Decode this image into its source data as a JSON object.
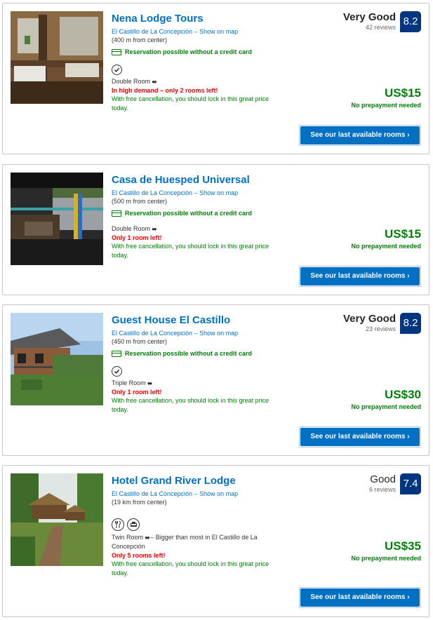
{
  "properties": [
    {
      "name": "Nena Lodge Tours",
      "location": "El Castillo de La Concepción – Show on map",
      "distance": "(400 m from center)",
      "reservation_note": "Reservation possible without a credit card",
      "feature_icons": [
        "check-badge-icon"
      ],
      "room": "Double Room",
      "room_extra": "",
      "demand": "In high demand – only 2 rooms left!",
      "cancel": "With free cancellation, you should lock in this great price today.",
      "review_word": "Very Good",
      "review_count": "42 reviews",
      "score": "8.2",
      "price": "US$15",
      "prepay": "No prepayment needed",
      "cta": "See our last available rooms ›"
    },
    {
      "name": "Casa de Huesped Universal",
      "location": "El Castillo de La Concepción – Show on map",
      "distance": "(500 m from center)",
      "reservation_note": "Reservation possible without a credit card",
      "feature_icons": [],
      "room": "Double Room",
      "room_extra": "",
      "demand": "Only 1 room left!",
      "cancel": "With free cancellation, you should lock in this great price today.",
      "review_word": "",
      "review_count": "",
      "score": "",
      "price": "US$15",
      "prepay": "No prepayment needed",
      "cta": "See our last available rooms ›"
    },
    {
      "name": "Guest House El Castillo",
      "location": "El Castillo de La Concepción – Show on map",
      "distance": "(450 m from center)",
      "reservation_note": "Reservation possible without a credit card",
      "feature_icons": [
        "check-badge-icon"
      ],
      "room": "Triple Room",
      "room_extra": "",
      "demand": "Only 1 room left!",
      "cancel": "With free cancellation, you should lock in this great price today.",
      "review_word": "Very Good",
      "review_count": "23 reviews",
      "score": "8.2",
      "price": "US$30",
      "prepay": "No prepayment needed",
      "cta": "See our last available rooms ›"
    },
    {
      "name": "Hotel Grand River Lodge",
      "location": "El Castillo de La Concepción – Show on map",
      "distance": "(19 km from center)",
      "reservation_note": "",
      "feature_icons": [
        "restaurant-icon",
        "taxi-icon"
      ],
      "room": "Twin Room",
      "room_extra": "– Bigger than most in El Castillo de La Concepción",
      "demand": "Only 5 rooms left!",
      "cancel": "With free cancellation, you should lock in this great price today.",
      "review_word": "Good",
      "review_count": "6 reviews",
      "score": "7.4",
      "price": "US$35",
      "prepay": "No prepayment needed",
      "cta": "See our last available rooms ›"
    }
  ]
}
